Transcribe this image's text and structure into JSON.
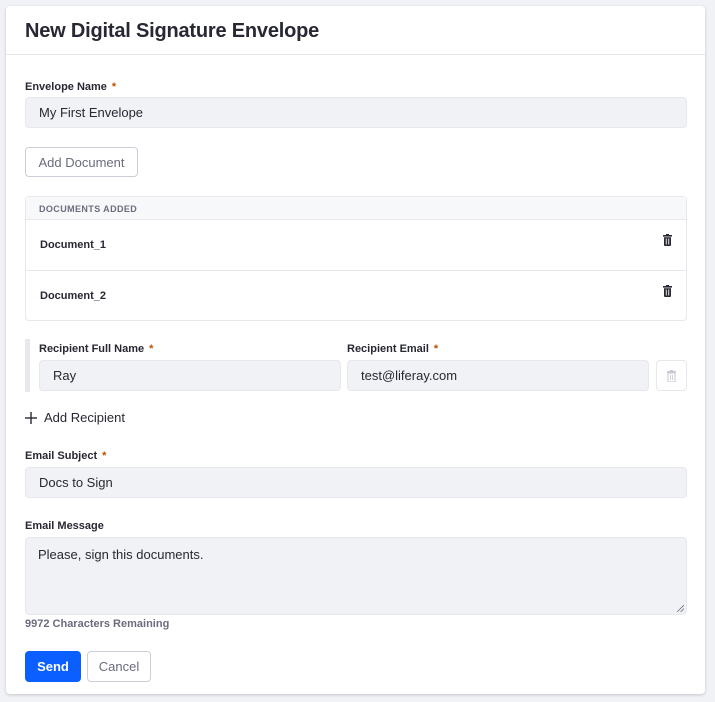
{
  "header": {
    "title": "New Digital Signature Envelope"
  },
  "envelope_name": {
    "label": "Envelope Name",
    "required_mark": "*",
    "value": "My First Envelope"
  },
  "add_document": {
    "label": "Add Document"
  },
  "documents": {
    "header": "DOCUMENTS ADDED",
    "items": [
      {
        "name": "Document_1"
      },
      {
        "name": "Document_2"
      }
    ]
  },
  "recipient": {
    "name_label": "Recipient Full Name",
    "email_label": "Recipient Email",
    "required_mark": "*",
    "name_value": "Ray",
    "email_value": "test@liferay.com"
  },
  "add_recipient": {
    "label": "Add Recipient"
  },
  "email_subject": {
    "label": "Email Subject",
    "required_mark": "*",
    "value": "Docs to Sign"
  },
  "email_message": {
    "label": "Email Message",
    "value": "Please, sign this documents."
  },
  "chars_remaining": "9972 Characters Remaining",
  "actions": {
    "send_label": "Send",
    "cancel_label": "Cancel"
  },
  "colors": {
    "primary": "#0b5fff",
    "required": "#b95000",
    "field_bg": "#f1f2f5",
    "border": "#e7e7ed"
  },
  "icons": {
    "trash": "trash-icon",
    "plus": "plus-icon"
  }
}
